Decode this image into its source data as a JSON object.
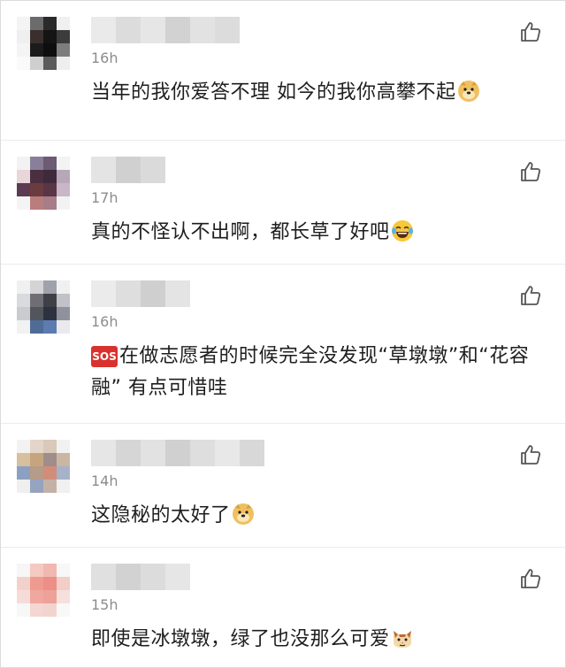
{
  "comments": [
    {
      "time": "16h",
      "text": "当年的我你爱答不理 如今的我你高攀不起",
      "emoji": "doge-emoji",
      "avatar_colors": [
        "#f4f4f4",
        "#6b6b6b",
        "#2a2a2a",
        "#f0f0f0",
        "#efefef",
        "#3a2f2c",
        "#141414",
        "#3c3c3c",
        "#f4f4f4",
        "#1b1b1b",
        "#0e0e0e",
        "#7d7d7d",
        "#fafafa",
        "#cfcfcf",
        "#5b5b5b",
        "#eeeeee"
      ],
      "username_colors": [
        "#eaeaea",
        "#dcdcdc",
        "#e6e6e6",
        "#d2d2d2",
        "#e2e2e2",
        "#dcdcdc"
      ]
    },
    {
      "time": "17h",
      "text": "真的不怪认不出啊，都长草了好吧",
      "emoji": "laugh-tears-emoji",
      "avatar_colors": [
        "#f2f2f2",
        "#8a7f9a",
        "#6d5a73",
        "#f3f3f3",
        "#e8d6d9",
        "#4b2e40",
        "#3e2a3a",
        "#b8a7b7",
        "#5c3a52",
        "#6b3c3f",
        "#5a3545",
        "#c9b6c6",
        "#f4f4f4",
        "#b97d7e",
        "#a67d88",
        "#f2f2f2"
      ],
      "username_colors": [
        "#e4e4e4",
        "#d0d0d0",
        "#dadada"
      ]
    },
    {
      "time": "16h",
      "text_after_sos": "在做志愿者的时候完全没发现“草墩墩”和“花容融” 有点可惜哇",
      "sos_label": "SOS",
      "avatar_colors": [
        "#f0f0f0",
        "#d4d4d6",
        "#9fa2ab",
        "#f0f0f0",
        "#d9dadd",
        "#6f6e74",
        "#3f4047",
        "#c1c2c8",
        "#c9cbd1",
        "#53555c",
        "#2d3240",
        "#8f929c",
        "#f2f2f2",
        "#4f6c96",
        "#5c7bb0",
        "#eaeaec"
      ],
      "username_colors": [
        "#ebebeb",
        "#dedede",
        "#cfcfcf",
        "#e4e4e4"
      ]
    },
    {
      "time": "14h",
      "text": "这隐秘的太好了",
      "emoji": "doge-emoji",
      "avatar_colors": [
        "#f2f2f2",
        "#e3d5c9",
        "#d9c9b8",
        "#f1f1f1",
        "#d8c09e",
        "#c5a57e",
        "#9f8d8c",
        "#cbb6a2",
        "#8ca0c2",
        "#b69b88",
        "#d28d7a",
        "#a6b2c8",
        "#efefef",
        "#96a3bf",
        "#c4b1a6",
        "#f0f0f0"
      ],
      "username_colors": [
        "#e6e6e6",
        "#d6d6d6",
        "#e2e2e2",
        "#d0d0d0",
        "#dedede",
        "#e8e8e8",
        "#d8d8d8"
      ]
    },
    {
      "time": "15h",
      "text": "即使是冰墩墩，绿了也没那么可爱",
      "emoji": "cat-emoji",
      "avatar_colors": [
        "#f6f6f6",
        "#f4c9c2",
        "#f0b8b0",
        "#f7f7f7",
        "#f3d1cb",
        "#ef9a8f",
        "#ec8f86",
        "#f4cdc7",
        "#f6dcd8",
        "#f0a79e",
        "#eda198",
        "#f6e0dd",
        "#f7f7f7",
        "#f4d6d2",
        "#f3d3ce",
        "#f8f8f8"
      ],
      "username_colors": [
        "#e0e0e0",
        "#d2d2d2",
        "#dcdcdc",
        "#e6e6e6"
      ]
    }
  ]
}
